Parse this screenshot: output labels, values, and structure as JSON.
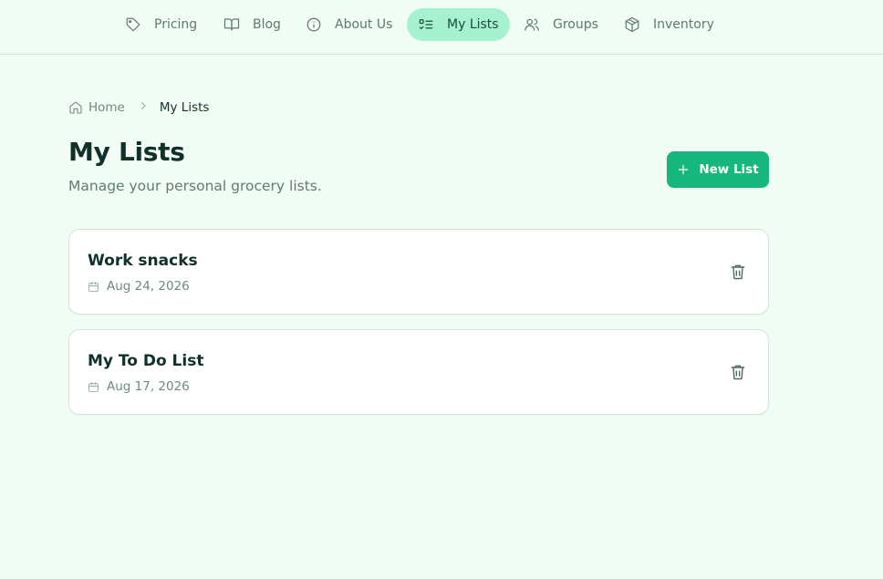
{
  "nav": {
    "items": [
      {
        "label": "Pricing",
        "icon": "tag-icon"
      },
      {
        "label": "Blog",
        "icon": "book-open-icon"
      },
      {
        "label": "About Us",
        "icon": "info-icon"
      },
      {
        "label": "My Lists",
        "icon": "list-checks-icon",
        "active": true
      },
      {
        "label": "Groups",
        "icon": "users-icon"
      },
      {
        "label": "Inventory",
        "icon": "package-icon"
      }
    ]
  },
  "breadcrumb": {
    "home": "Home",
    "current": "My Lists"
  },
  "page": {
    "title": "My Lists",
    "subtitle": "Manage your personal grocery lists.",
    "new_list_label": "New List"
  },
  "lists": [
    {
      "name": "Work snacks",
      "date": "Aug 24, 2026"
    },
    {
      "name": "My To Do List",
      "date": "Aug 17, 2026"
    }
  ],
  "colors": {
    "background": "#f1fcf5",
    "accent": "#16b67c",
    "active_nav": "#a6f2d0",
    "text_dark": "#10302a",
    "text_muted": "#6e8a80"
  }
}
